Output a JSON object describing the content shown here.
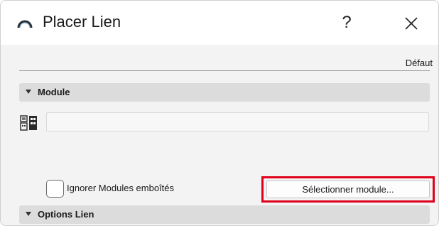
{
  "dialog": {
    "title": "Placer Lien",
    "help_label": "?",
    "default_label": "Défaut"
  },
  "sections": {
    "module": {
      "label": "Module"
    },
    "options_lien": {
      "label": "Options Lien"
    }
  },
  "module": {
    "field_value": "",
    "ignore_nested_label": "Ignorer Modules emboîtés",
    "ignore_nested_checked": false,
    "select_button_label": "Sélectionner module..."
  },
  "colors": {
    "highlight": "#e0001b",
    "section_header_bg": "#dcdcdc",
    "dialog_bg": "#f3f3f3"
  },
  "icons": {
    "app": "archicad-arc-icon",
    "close": "close-icon",
    "module": "module-building-icon",
    "section_toggle": "triangle-down-icon"
  }
}
